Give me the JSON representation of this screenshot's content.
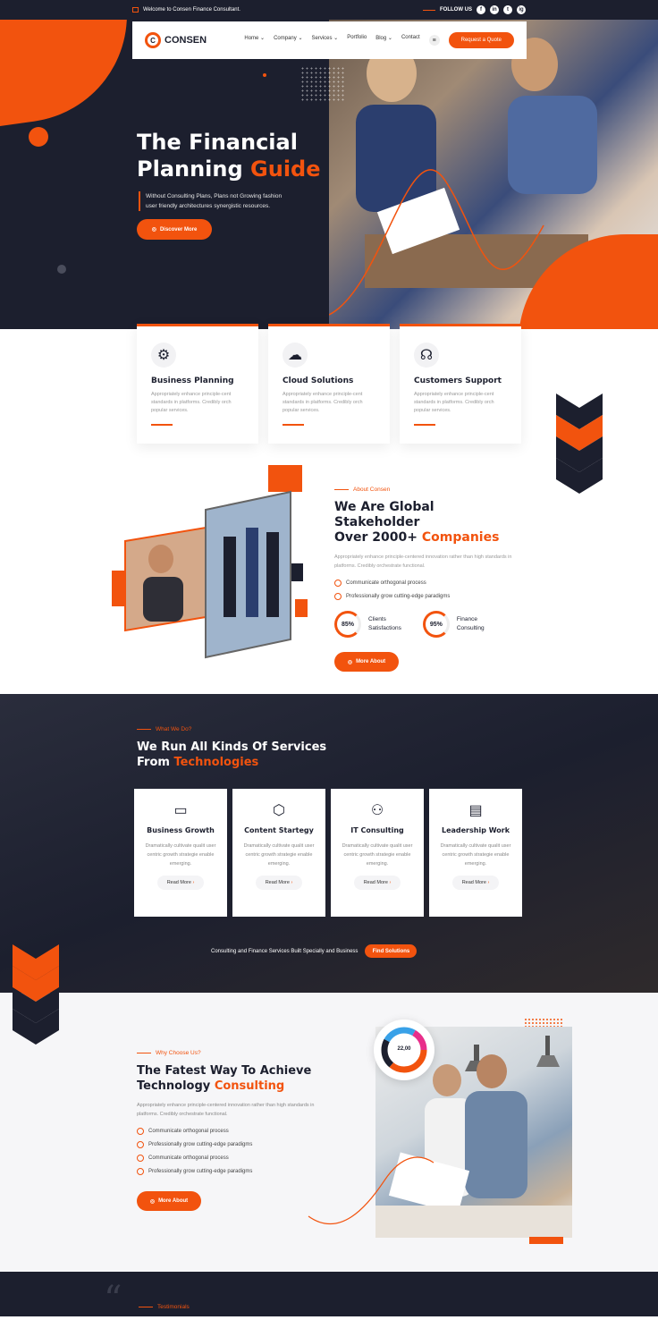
{
  "topbar": {
    "welcome": "Welcome to Consen Finance Consultant.",
    "follow": "FOLLOW US",
    "socials": [
      "f",
      "in",
      "t",
      "ig"
    ]
  },
  "nav": {
    "brand": "CONSEN",
    "items": [
      "Home",
      "Company",
      "Services",
      "Portfolio",
      "Blog",
      "Contact"
    ],
    "cta": "Request a Quote"
  },
  "hero": {
    "title_main": "The Financial Planning",
    "title_accent": "Guide",
    "subtitle": "Without Consulting Plans, Plans not Growing fashion user friendly architectures synergistic resources.",
    "button": "Discover More"
  },
  "features": [
    {
      "icon": "business-planning-icon",
      "title": "Business Planning",
      "text": "Appropriately enhance principle-cent standards in platforms. Credibly orch popular services."
    },
    {
      "icon": "cloud-solutions-icon",
      "title": "Cloud Solutions",
      "text": "Appropriately enhance principle-cent standards in platforms. Credibly orch popular services."
    },
    {
      "icon": "customer-support-icon",
      "title": "Customers Support",
      "text": "Appropriately enhance principle-cent standards in platforms. Credibly orch popular services."
    }
  ],
  "about": {
    "label": "About Consen",
    "title_1": "We Are Global Stakeholder",
    "title_2": "Over 2000+",
    "title_accent": "Companies",
    "text": "Appropriately enhance principle-centered innovation rather than high standards in platforms. Credibly orchestrate functional.",
    "checks": [
      "Communicate orthogonal process",
      "Professionally grow cutting-edge paradigms"
    ],
    "stats": [
      {
        "value": "85%",
        "label_1": "Clients",
        "label_2": "Satisfactions",
        "fraction": 0.85
      },
      {
        "value": "95%",
        "label_1": "Finance",
        "label_2": "Consulting",
        "fraction": 0.95
      }
    ],
    "button": "More About"
  },
  "services": {
    "label": "What We Do?",
    "title_1": "We Run All Kinds Of Services",
    "title_2": "From",
    "title_accent": "Technologies",
    "cards": [
      {
        "icon": "business-growth-icon",
        "title": "Business Growth",
        "text": "Dramatically cultivate qualit user centric growth strategie enable emerging.",
        "link": "Read More"
      },
      {
        "icon": "content-strategy-icon",
        "title": "Content Startegy",
        "text": "Dramatically cultivate qualit user centric growth strategie enable emerging.",
        "link": "Read More"
      },
      {
        "icon": "it-consulting-icon",
        "title": "IT Consulting",
        "text": "Dramatically cultivate qualit user centric growth strategie enable emerging.",
        "link": "Read More"
      },
      {
        "icon": "leadership-work-icon",
        "title": "Leadership Work",
        "text": "Dramatically cultivate qualit user centric growth strategie enable emerging.",
        "link": "Read More"
      }
    ],
    "footer_text": "Consulting and Finance Services Built Specially and Business",
    "footer_button": "Find Solutions"
  },
  "why": {
    "label": "Why Choose Us?",
    "title_1": "The Fatest Way To Achieve",
    "title_2": "Technology",
    "title_accent": "Consulting",
    "text": "Appropriately enhance principle-centered innovation rather than high standards in platforms. Credibly orchestrate functional.",
    "checks": [
      "Communicate orthogonal process",
      "Professionally grow cutting-edge paradigms",
      "Communicate orthogonal process",
      "Professionally grow cutting-edge paradigms"
    ],
    "button": "More About",
    "badge": "22,00"
  },
  "testimonials": {
    "label": "Testimonials"
  },
  "colors": {
    "accent": "#f2530e",
    "dark": "#1c1f2e"
  }
}
